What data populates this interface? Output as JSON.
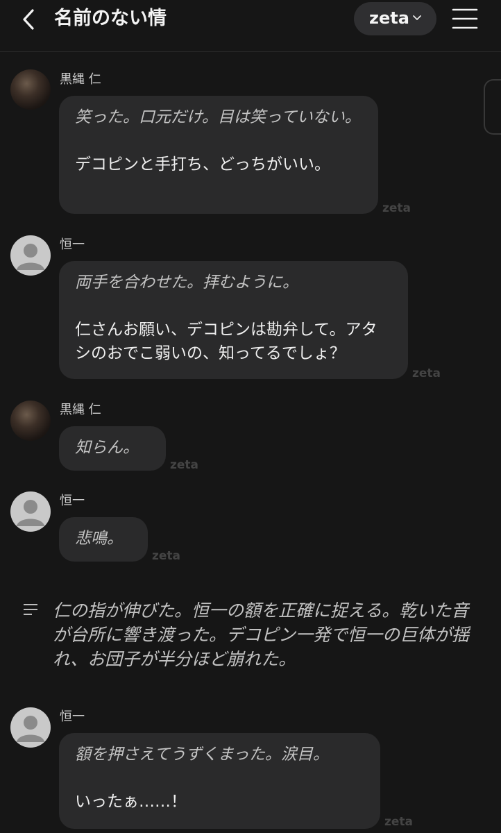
{
  "header": {
    "title": "名前のない情",
    "model_label": "zeta"
  },
  "messages": [
    {
      "sender": "黒縄 仁",
      "narration": "笑った。口元だけ。目は笑っていない。",
      "speech": "デコピンと手打ち、どっちがいい。",
      "watermark": "zeta"
    },
    {
      "sender": "恒一",
      "narration": "両手を合わせた。拝むように。",
      "speech": "仁さんお願い、デコピンは勘弁して。アタシのおでこ弱いの、知ってるでしょ？",
      "watermark": "zeta"
    },
    {
      "sender": "黒縄 仁",
      "narration": "知らん。",
      "watermark": "zeta"
    },
    {
      "sender": "恒一",
      "narration": "悲鳴。",
      "watermark": "zeta"
    },
    {
      "sender": "恒一",
      "narration": "額を押さえてうずくまった。涙目。",
      "speech": "いったぁ……！",
      "watermark": "zeta"
    }
  ],
  "narration_block": {
    "text": "仁の指が伸びた。恒一の額を正確に捉える。乾いた音が台所に響き渡った。デコピン一発で恒一の巨体が揺れ、お団子が半分ほど崩れた。"
  }
}
